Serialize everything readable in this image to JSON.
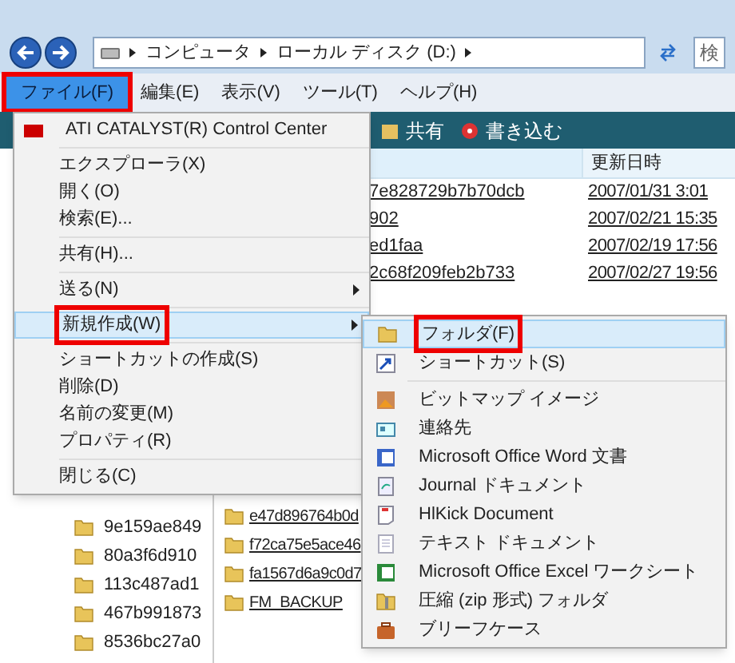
{
  "address_bar": {
    "path": [
      "コンピュータ",
      "ローカル ディスク (D:)"
    ],
    "search_placeholder": "検"
  },
  "menu_bar": [
    {
      "label": "ファイル(F)",
      "selected": true
    },
    {
      "label": "編集(E)",
      "selected": false
    },
    {
      "label": "表示(V)",
      "selected": false
    },
    {
      "label": "ツール(T)",
      "selected": false
    },
    {
      "label": "ヘルプ(H)",
      "selected": false
    }
  ],
  "toolbar": [
    "共有",
    "書き込む"
  ],
  "file_list": {
    "columns": [
      "更新日時"
    ],
    "rows": [
      {
        "name": "7e828729b7b70dcb",
        "modified": "2007/01/31 3:01"
      },
      {
        "name": "902",
        "modified": "2007/02/21 15:35"
      },
      {
        "name": "ed1faa",
        "modified": "2007/02/19 17:56"
      },
      {
        "name": "2c68f209feb2b733",
        "modified": "2007/02/27 19:56"
      }
    ],
    "lower_rows": [
      "e47d896764b0d",
      "f72ca75e5ace46",
      "fa1567d6a9c0d7",
      "FM_BACKUP"
    ]
  },
  "navigation_pane": [
    "9e159ae849",
    "80a3f6d910",
    "113c487ad1",
    "467b991873",
    "8536bc27a0"
  ],
  "file_menu": [
    {
      "kind": "item",
      "label": "ATI CATALYST(R) Control Center",
      "selected": false,
      "submenu": false
    },
    {
      "kind": "separator"
    },
    {
      "kind": "item",
      "label": "エクスプローラ(X)",
      "selected": false,
      "submenu": false
    },
    {
      "kind": "item",
      "label": "開く(O)",
      "selected": false,
      "submenu": false
    },
    {
      "kind": "item",
      "label": "検索(E)...",
      "selected": false,
      "submenu": false
    },
    {
      "kind": "separator"
    },
    {
      "kind": "item",
      "label": "共有(H)...",
      "selected": false,
      "submenu": false
    },
    {
      "kind": "separator"
    },
    {
      "kind": "item",
      "label": "送る(N)",
      "selected": false,
      "submenu": true
    },
    {
      "kind": "separator"
    },
    {
      "kind": "item",
      "label": "新規作成(W)",
      "selected": true,
      "submenu": true
    },
    {
      "kind": "separator"
    },
    {
      "kind": "item",
      "label": "ショートカットの作成(S)",
      "selected": false,
      "submenu": false
    },
    {
      "kind": "item",
      "label": "削除(D)",
      "selected": false,
      "submenu": false
    },
    {
      "kind": "item",
      "label": "名前の変更(M)",
      "selected": false,
      "submenu": false
    },
    {
      "kind": "item",
      "label": "プロパティ(R)",
      "selected": false,
      "submenu": false
    },
    {
      "kind": "separator"
    },
    {
      "kind": "item",
      "label": "閉じる(C)",
      "selected": false,
      "submenu": false
    }
  ],
  "new_submenu": [
    {
      "kind": "item",
      "label": "フォルダ(F)",
      "selected": true
    },
    {
      "kind": "item",
      "label": "ショートカット(S)",
      "selected": false
    },
    {
      "kind": "separator"
    },
    {
      "kind": "item",
      "label": "ビットマップ イメージ",
      "selected": false
    },
    {
      "kind": "item",
      "label": "連絡先",
      "selected": false
    },
    {
      "kind": "item",
      "label": "Microsoft Office Word 文書",
      "selected": false
    },
    {
      "kind": "item",
      "label": "Journal ドキュメント",
      "selected": false
    },
    {
      "kind": "item",
      "label": "HlKick Document",
      "selected": false
    },
    {
      "kind": "item",
      "label": "テキスト ドキュメント",
      "selected": false
    },
    {
      "kind": "item",
      "label": "Microsoft Office Excel ワークシート",
      "selected": false
    },
    {
      "kind": "item",
      "label": "圧縮 (zip 形式) フォルダ",
      "selected": false
    },
    {
      "kind": "item",
      "label": "ブリーフケース",
      "selected": false
    }
  ]
}
